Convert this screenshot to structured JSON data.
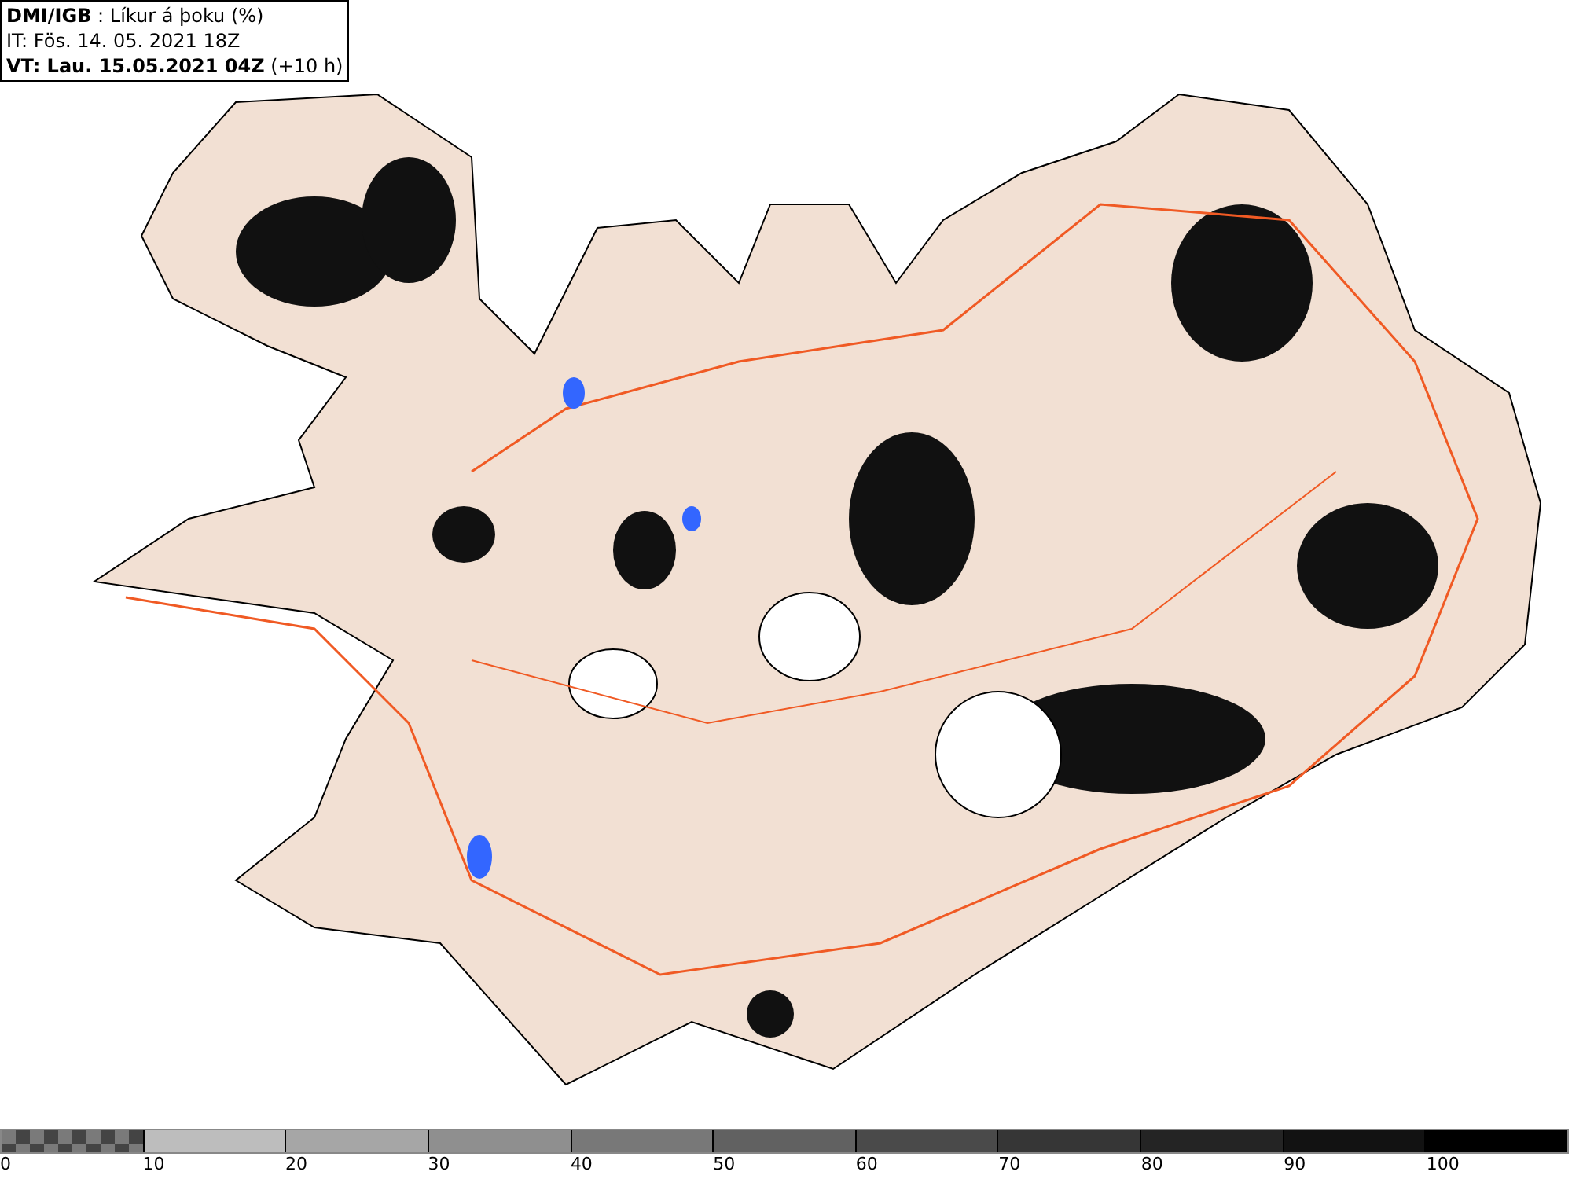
{
  "header": {
    "title": "**DMI/IGB** : Líkur á þoku (%)",
    "issue_time": "IT: Fös. 14. 05. 2021 18Z",
    "valid_time": "**VT: Lau. 15.05.2021 04Z** (+10 h)"
  },
  "legend": [
    {
      "label": "0",
      "kind": "checker",
      "color": "#7a7a7a"
    },
    {
      "label": "10",
      "kind": "solid",
      "color": "#bdbdbd"
    },
    {
      "label": "20",
      "kind": "solid",
      "color": "#a6a6a6"
    },
    {
      "label": "30",
      "kind": "solid",
      "color": "#8f8f8f"
    },
    {
      "label": "40",
      "kind": "solid",
      "color": "#787878"
    },
    {
      "label": "50",
      "kind": "solid",
      "color": "#616161"
    },
    {
      "label": "60",
      "kind": "solid",
      "color": "#4a4a4a"
    },
    {
      "label": "70",
      "kind": "solid",
      "color": "#363636"
    },
    {
      "label": "80",
      "kind": "solid",
      "color": "#242424"
    },
    {
      "label": "90",
      "kind": "solid",
      "color": "#121212"
    },
    {
      "label": "100",
      "kind": "solid",
      "color": "#000000"
    }
  ]
}
